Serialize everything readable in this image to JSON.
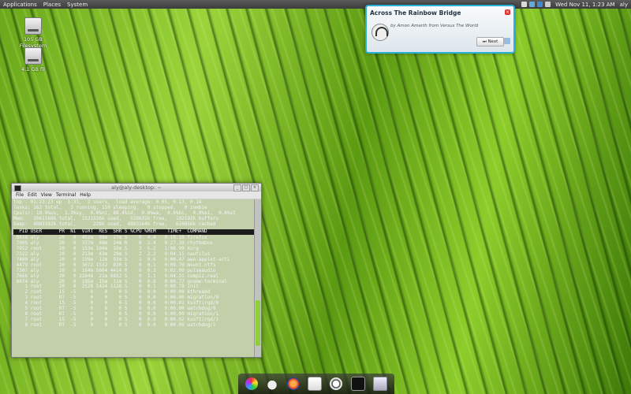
{
  "top_panel": {
    "menus": [
      "Applications",
      "Places",
      "System"
    ],
    "clock": "Wed Nov 11,  1:23 AM",
    "user": "aly"
  },
  "desktop_icons": [
    {
      "label": "105 GB Filesystem",
      "icon": "drive-icon"
    },
    {
      "label": "4.1 GB fil",
      "icon": "drive-icon"
    }
  ],
  "notification": {
    "title": "Across The Rainbow Bridge",
    "body": "by Amon Amarth from Versus The World",
    "button": "Next",
    "icon": "headphones-icon"
  },
  "terminal": {
    "title": "aly@aly-desktop: ~",
    "menus": [
      "File",
      "Edit",
      "View",
      "Terminal",
      "Help"
    ],
    "summary": [
      "top - 01:23:23 up  1:31,  2 users,  load average: 0.05, 0.13, 0.14",
      "Tasks: 162 total,   3 running, 159 sleeping,   0 stopped,   0 zombie",
      "Cpu(s): 10.9%us,  1.3%sy,  0.0%ni, 88.4%id,  0.0%wa,  0.0%hi,  0.0%si,  0.0%st",
      "Mem:   2061168k total,  1531536k used,   529632k free,   192192k buffers",
      "Swap:  4883392k total,      228k used,  4883164k free,   628856k cached"
    ],
    "proc_header": "  PID USER      PR  NI  VIRT  RES  SHR S %CPU %MEM    TIME+  COMMAND",
    "processes": [
      " 8038 aly       20   0  452m  88m  27m S    9  4.4   0:19.10 firefox",
      " 7905 aly       20   0  337m  48m  24m R    8  2.4   0:27.39 rhythmbox",
      " 7952 root      20   0  153m 104m  33m S    3  5.2   1:08.99 Xorg",
      " 7322 aly       20   0  213m  43m  29m S    2  2.2   0:04.15 nautilus",
      " 7400 aly       20   0  159m  12m  92m S    1  0.6   0:00.47 awn-applet-acti",
      " 4479 root      20   0  3072 1532  820 S    0  0.1   0:09.70 mount.ntfs",
      " 7307 aly       20   0  164m 5604 4414 R    0  0.3   0:02.00 pulseaudio",
      " 7666 aly       20   0 31048  21m 6652 S    0  1.1   0:04.31 compiz.real",
      " 8074 aly       20   0  195m  15m  11m S    0  0.8   0:00.77 gnome-terminal",
      "    1 root      20   0  2528 1424 1128 S    0  0.1   0:00.78 init",
      "    2 root      15  -5     0    0    0 S    0  0.0   0:00.00 kthreadd",
      "    3 root      RT  -5     0    0    0 S    0  0.0   0:00.00 migration/0",
      "    4 root      15  -5     0    0    0 S    0  0.0   0:00.01 ksoftirqd/0",
      "    5 root      RT  -5     0    0    0 S    0  0.0   0:00.00 watchdog/0",
      "    6 root      RT  -5     0    0    0 S    0  0.0   0:00.00 migration/1",
      "    7 root      15  -5     0    0    0 S    0  0.0   0:00.02 ksoftirqd/1",
      "    8 root      RT  -5     0    0    0 S    0  0.0   0:00.00 watchdog/1"
    ]
  },
  "dock": {
    "icons": [
      "pinwheel-icon",
      "cloud-icon",
      "firefox-icon",
      "file-manager-icon",
      "music-player-icon",
      "terminal-icon",
      "trash-icon"
    ]
  },
  "colors": {
    "notification_border": "#2ab0d6",
    "term_header_bg": "#1c1c1c",
    "scroll_thumb": "#8fcf3a"
  }
}
